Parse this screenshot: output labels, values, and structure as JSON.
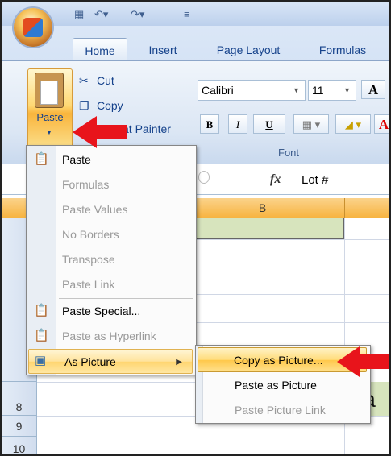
{
  "ribbon": {
    "tabs": [
      {
        "label": "Home",
        "active": true
      },
      {
        "label": "Insert",
        "active": false
      },
      {
        "label": "Page Layout",
        "active": false
      },
      {
        "label": "Formulas",
        "active": false
      }
    ],
    "clipboard": {
      "paste_label": "Paste",
      "cut_label": "Cut",
      "copy_label": "Copy",
      "format_painter_label": "at Painter"
    },
    "font": {
      "name": "Calibri",
      "size": "11",
      "group_label": "Font",
      "bold": "B",
      "italic": "I",
      "underline": "U",
      "grow": "A",
      "color": "A"
    }
  },
  "formula_bar": {
    "fx_label": "fx",
    "value": "Lot #"
  },
  "grid": {
    "column_header": "B",
    "row_numbers": [
      "8",
      "9",
      "10"
    ],
    "cell_text": "la"
  },
  "paste_menu": {
    "items": [
      {
        "label": "Paste",
        "enabled": true,
        "icon": "paste-icon"
      },
      {
        "label": "Formulas",
        "enabled": false
      },
      {
        "label": "Paste Values",
        "enabled": false
      },
      {
        "label": "No Borders",
        "enabled": false
      },
      {
        "label": "Transpose",
        "enabled": false
      },
      {
        "label": "Paste Link",
        "enabled": false
      },
      {
        "label": "Paste Special...",
        "enabled": true,
        "icon": "paste-special-icon"
      },
      {
        "label": "Paste as Hyperlink",
        "enabled": false,
        "icon": "hyperlink-icon"
      },
      {
        "label": "As Picture",
        "enabled": true,
        "highlighted": true,
        "icon": "picture-icon"
      }
    ]
  },
  "picture_submenu": {
    "items": [
      {
        "label": "Copy as Picture...",
        "enabled": true,
        "highlighted": true
      },
      {
        "label": "Paste as Picture",
        "enabled": true
      },
      {
        "label": "Paste Picture Link",
        "enabled": false
      }
    ]
  },
  "colors": {
    "accent_arrow": "#e8141b",
    "ribbon_blue": "#15428b",
    "highlight": "#ffd570"
  }
}
